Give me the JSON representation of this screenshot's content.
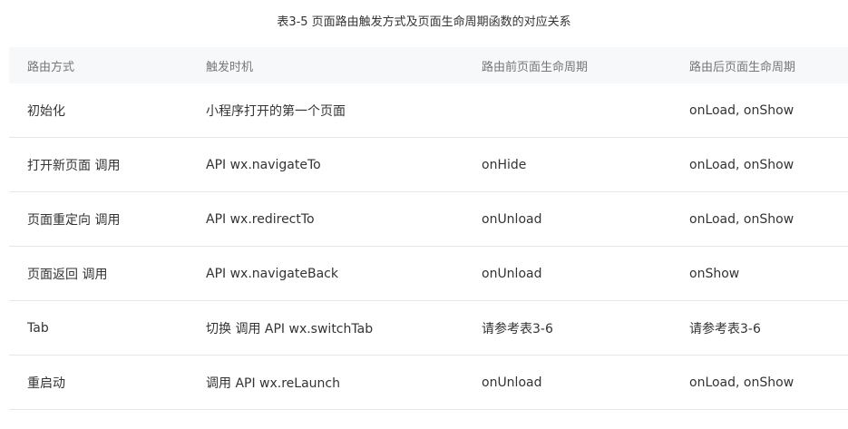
{
  "caption": "表3-5 页面路由触发方式及页面生命周期函数的对应关系",
  "table": {
    "headers": [
      "路由方式",
      "触发时机",
      "路由前页面生命周期",
      "路由后页面生命周期"
    ],
    "rows": [
      [
        "初始化",
        "小程序打开的第一个页面",
        "",
        "onLoad, onShow"
      ],
      [
        "打开新页面 调用",
        "API wx.navigateTo",
        "onHide",
        "onLoad, onShow"
      ],
      [
        "页面重定向 调用",
        "API wx.redirectTo",
        "onUnload",
        "onLoad, onShow"
      ],
      [
        "页面返回 调用",
        "API wx.navigateBack",
        "onUnload",
        "onShow"
      ],
      [
        "Tab",
        "切换 调用 API wx.switchTab",
        "请参考表3-6",
        "请参考表3-6"
      ],
      [
        "重启动",
        "调用 API wx.reLaunch",
        "onUnload",
        "onLoad, onShow"
      ]
    ]
  }
}
